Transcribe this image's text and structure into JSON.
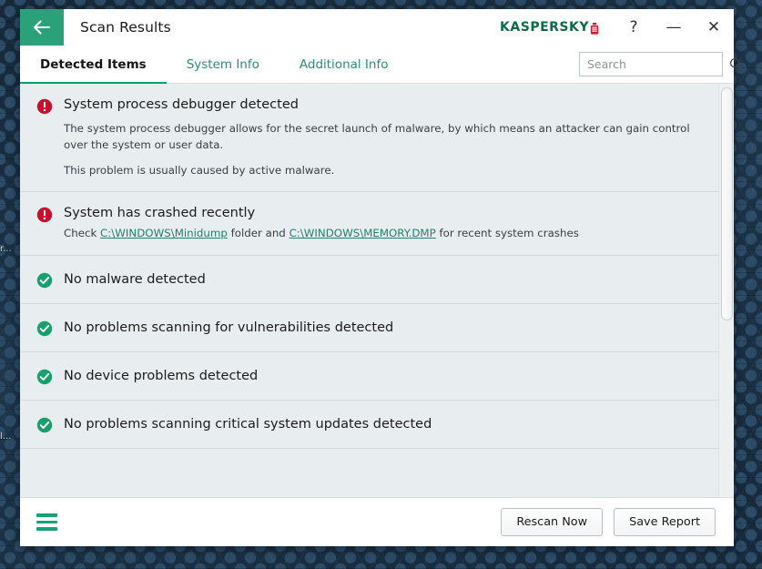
{
  "desktop": {
    "icon_labels": [
      "r...",
      "l..."
    ]
  },
  "window": {
    "title": "Scan Results",
    "back_icon": "arrow-left-icon",
    "brand": {
      "text_primary": "KA",
      "text_sep": "S",
      "text_mid": "PER",
      "text_accent": "SKY",
      "full": "KASPERSKY"
    },
    "controls": {
      "help": "?",
      "minimize": "—",
      "close": "✕"
    }
  },
  "tabs": [
    {
      "label": "Detected Items",
      "active": true
    },
    {
      "label": "System Info",
      "active": false
    },
    {
      "label": "Additional Info",
      "active": false
    }
  ],
  "search": {
    "placeholder": "Search",
    "value": "",
    "icon": "search-icon"
  },
  "results": [
    {
      "status": "error",
      "icon": "error-exclamation-icon",
      "title": "System process debugger detected",
      "paragraphs": [
        "The system process debugger allows for the secret launch of malware, by which means an attacker can gain control over the system or user data.",
        "This problem is usually caused by active malware."
      ]
    },
    {
      "status": "error",
      "icon": "error-exclamation-icon",
      "title": "System has crashed recently",
      "detail_prefix": "Check ",
      "link1": "C:\\WINDOWS\\Minidump",
      "detail_middle": " folder and ",
      "link2": "C:\\WINDOWS\\MEMORY.DMP",
      "detail_suffix": " for recent system crashes"
    },
    {
      "status": "ok",
      "icon": "check-circle-icon",
      "title": "No malware detected"
    },
    {
      "status": "ok",
      "icon": "check-circle-icon",
      "title": "No problems scanning for vulnerabilities detected"
    },
    {
      "status": "ok",
      "icon": "check-circle-icon",
      "title": "No device problems detected"
    },
    {
      "status": "ok",
      "icon": "check-circle-icon",
      "title": "No problems scanning critical system updates detected"
    }
  ],
  "footer": {
    "menu_icon": "hamburger-menu-icon",
    "rescan_label": "Rescan Now",
    "save_report_label": "Save Report"
  },
  "colors": {
    "accent_green": "#00a06d",
    "back_button_green": "#2aa179",
    "error_red": "#c8102e",
    "ok_green": "#17a06e",
    "link_green": "#23806a",
    "content_bg": "#e8edef",
    "brand_green": "#0d6b48",
    "brand_red": "#d01b2c"
  }
}
